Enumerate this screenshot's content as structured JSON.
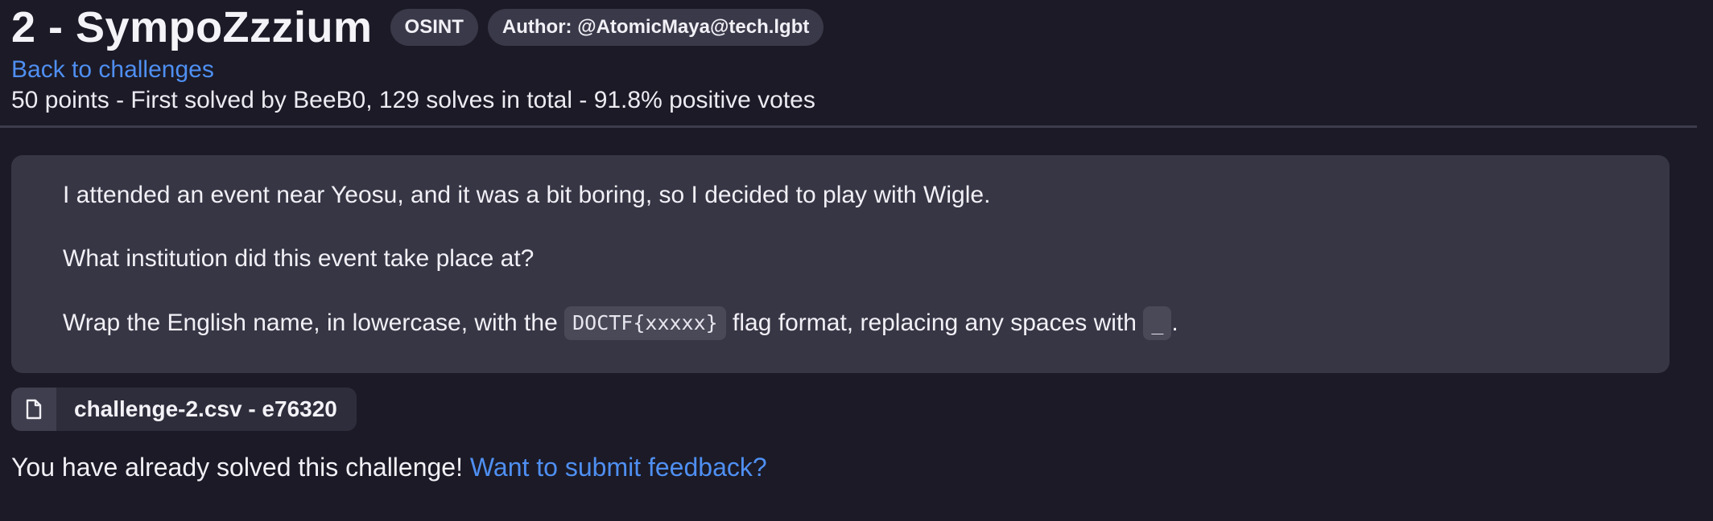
{
  "challenge": {
    "title": "2 - SympoZzzium",
    "category": "OSINT",
    "author": "Author: @AtomicMaya@tech.lgbt",
    "back_link": "Back to challenges",
    "meta": "50 points - First solved by BeeB0, 129 solves in total - 91.8% positive votes"
  },
  "description": {
    "line1": "I attended an event near Yeosu, and it was a bit boring, so I decided to play with Wigle.",
    "line2": "What institution did this event take place at?",
    "line3_before": "Wrap the English name, in lowercase, with the ",
    "line3_code1": "DOCTF{xxxxx}",
    "line3_middle": " flag format, replacing any spaces with ",
    "line3_code2": "_",
    "line3_end": "."
  },
  "attachment": {
    "icon": "file-icon",
    "label": "challenge-2.csv - e76320"
  },
  "status": {
    "solved_text": "You have already solved this challenge! ",
    "feedback_link": "Want to submit feedback?"
  }
}
